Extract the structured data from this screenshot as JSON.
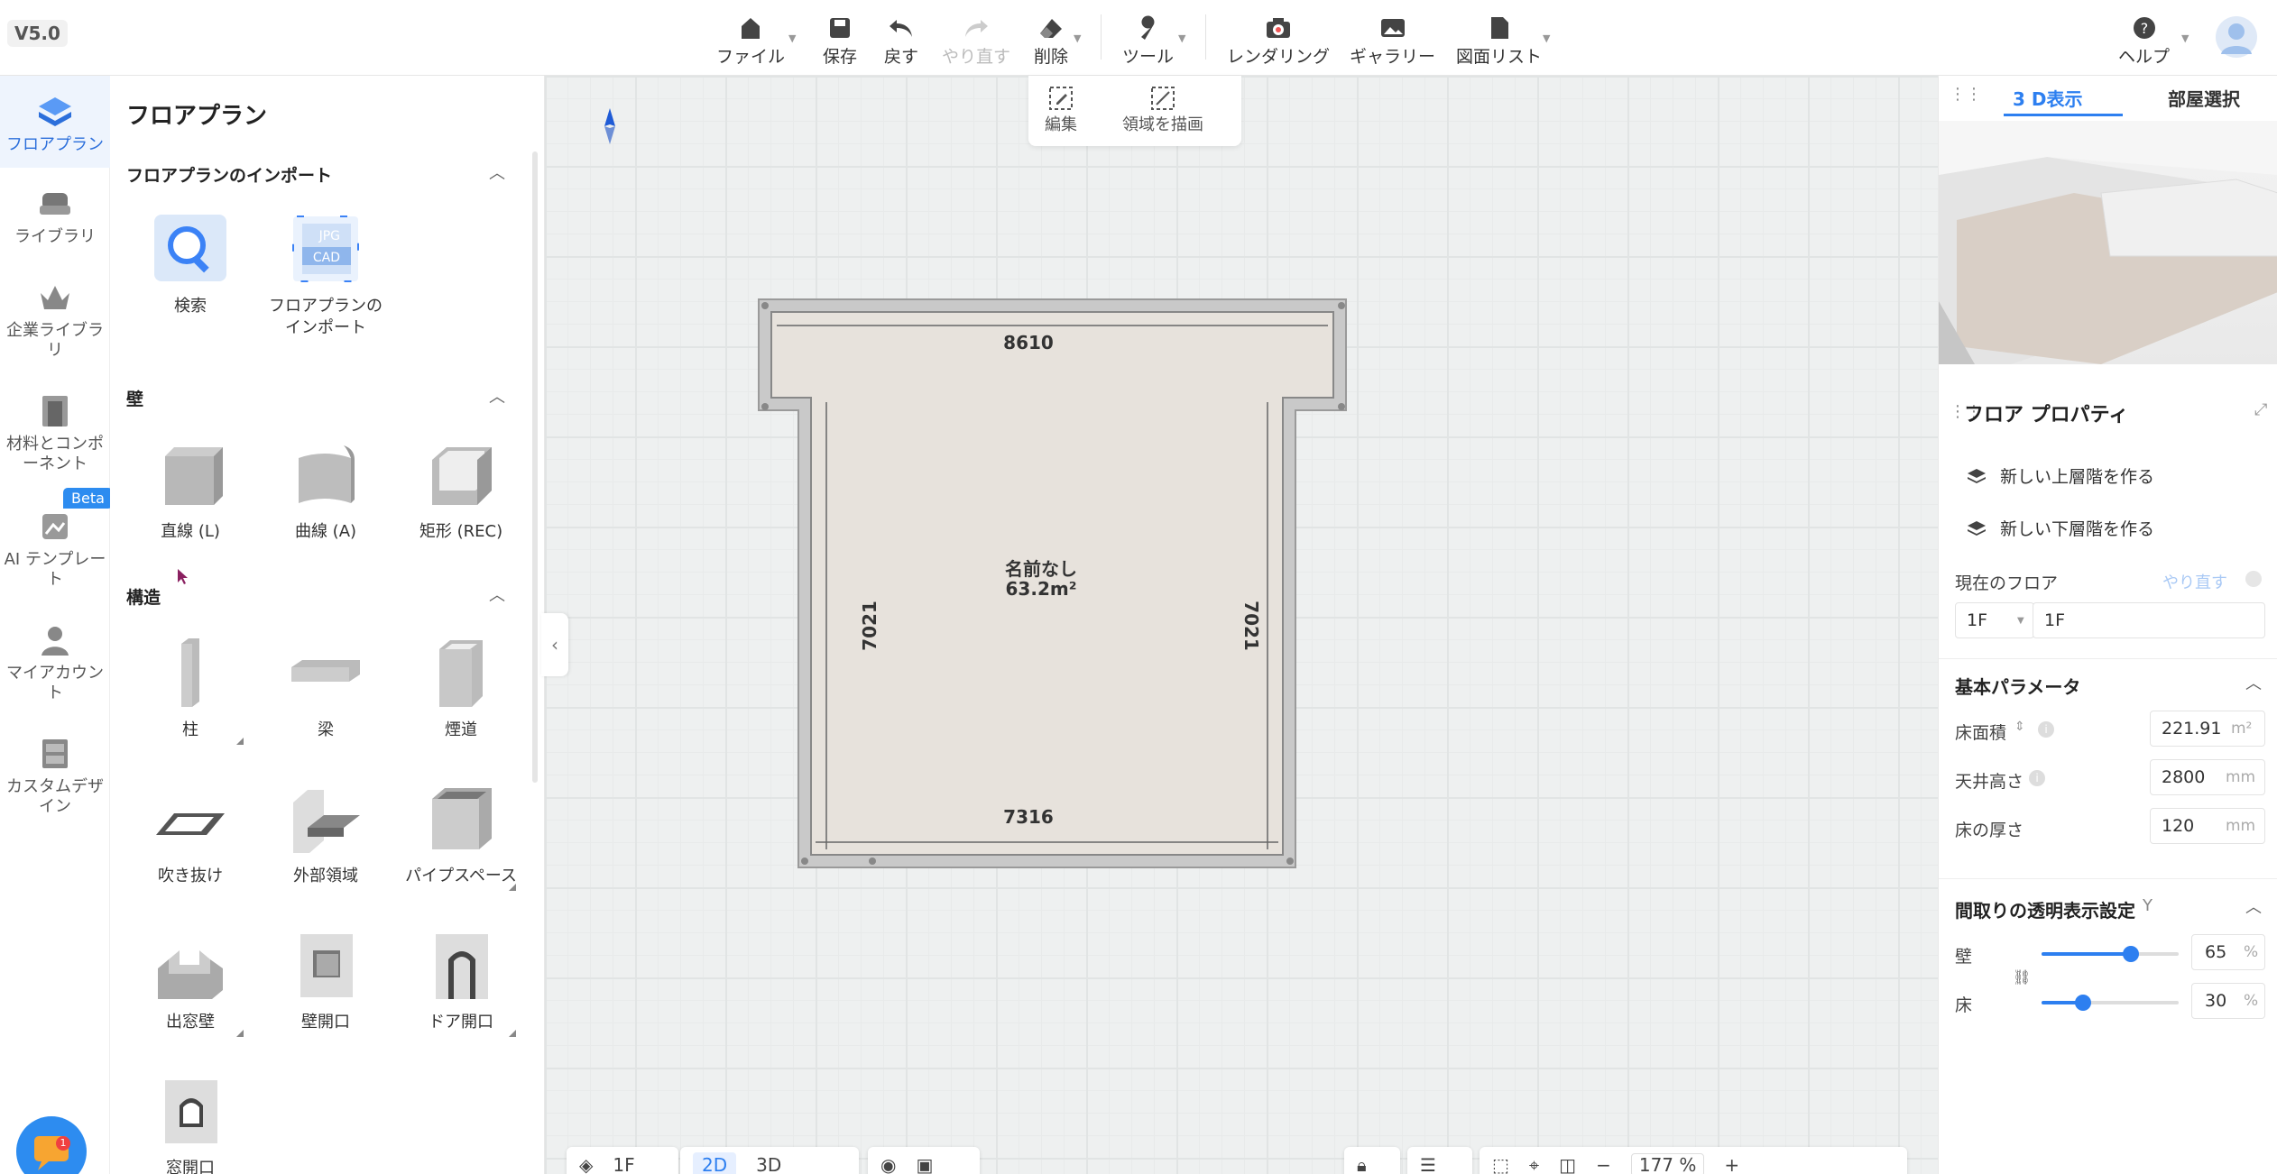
{
  "app": {
    "version": "V5.0"
  },
  "toolbar": {
    "file": "ファイル",
    "save": "保存",
    "undo": "戻す",
    "redo": "やり直す",
    "delete": "削除",
    "tools": "ツール",
    "rendering": "レンダリング",
    "gallery": "ギャラリー",
    "drawing_list": "図面リスト",
    "help": "ヘルプ"
  },
  "rail": [
    {
      "label": "フロアプラン",
      "icon": "floorplan-icon",
      "active": true
    },
    {
      "label": "ライブラリ",
      "icon": "library-icon"
    },
    {
      "label": "企業ライブラリ",
      "icon": "crown-icon"
    },
    {
      "label": "材料とコンポーネント",
      "icon": "door-icon"
    },
    {
      "label": "AI テンプレート",
      "icon": "ai-template-icon",
      "badge": "Beta"
    },
    {
      "label": "マイアカウント",
      "icon": "user-icon"
    },
    {
      "label": "カスタムデザイン",
      "icon": "cabinet-icon"
    }
  ],
  "catalog": {
    "title": "フロアプラン",
    "import_section": "フロアプランのインポート",
    "import_items": [
      "検索",
      "フロアプランの\nインポート"
    ],
    "import_thumb_text": [
      "JPG",
      "CAD"
    ],
    "wall_section": "壁",
    "wall_items": [
      "直線 (L)",
      "曲線 (A)",
      "矩形 (REC)"
    ],
    "structure_section": "構造",
    "structure_items": [
      "柱",
      "梁",
      "煙道",
      "吹き抜け",
      "外部領域",
      "パイプスペース",
      "出窓壁",
      "壁開口",
      "ドア開口",
      "窓開口"
    ]
  },
  "canvas": {
    "edit_bar": {
      "edit": "編集",
      "draw_area": "領域を描画"
    },
    "room": {
      "name": "名前なし",
      "area": "63.2m²"
    },
    "dims": {
      "top": "8610",
      "bottom": "7316",
      "left": "7021",
      "right": "7021"
    }
  },
  "bottom_bar": {
    "floor": "1F",
    "view_2d": "2D",
    "view_3d": "3D",
    "zoom": "177",
    "zoom_unit": "%"
  },
  "right_panel": {
    "tab_3d": "3 D表示",
    "tab_room": "部屋選択",
    "props_title": "フロア プロパティ",
    "new_upper": "新しい上層階を作る",
    "new_lower": "新しい下層階を作る",
    "current_floor_label": "現在のフロア",
    "redo_label": "やり直す",
    "floor_select": "1F",
    "floor_name": "1F",
    "basic_params": "基本パラメータ",
    "floor_area_label": "床面積",
    "floor_area": "221.91",
    "floor_area_unit": "m²",
    "ceiling_label": "天井高さ",
    "ceiling": "2800",
    "ceiling_unit": "mm",
    "thickness_label": "床の厚さ",
    "thickness": "120",
    "thickness_unit": "mm",
    "transparency_title": "間取りの透明表示設定",
    "transparency_shortcut": "Y",
    "wall_label": "壁",
    "wall_value": "65",
    "floor_label": "床",
    "floor_value": "30",
    "percent": "%"
  },
  "colors": {
    "accent": "#2d7ff0",
    "room_fill": "#e9e4df",
    "wall": "#c8c8c8"
  }
}
